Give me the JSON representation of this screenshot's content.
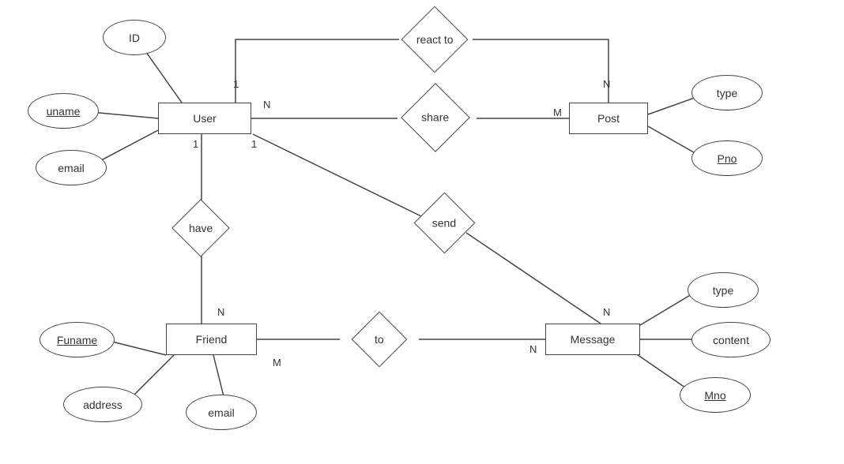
{
  "entities": {
    "user": "User",
    "post": "Post",
    "friend": "Friend",
    "message": "Message"
  },
  "relationships": {
    "react_to": "react to",
    "share": "share",
    "have": "have",
    "send": "send",
    "to": "to"
  },
  "attributes": {
    "user_id": "ID",
    "user_uname": "uname",
    "user_email": "email",
    "post_type": "type",
    "post_pno": "Pno",
    "friend_funame": "Funame",
    "friend_address": "address",
    "friend_email": "email",
    "msg_type": "type",
    "msg_content": "content",
    "msg_mno": "Mno"
  },
  "cardinalities": {
    "react_user": "1",
    "react_post": "N",
    "share_user": "N",
    "share_post": "M",
    "have_user": "1",
    "have_friend": "N",
    "send_user": "1",
    "send_msg": "N",
    "to_friend": "M",
    "to_msg": "N"
  }
}
